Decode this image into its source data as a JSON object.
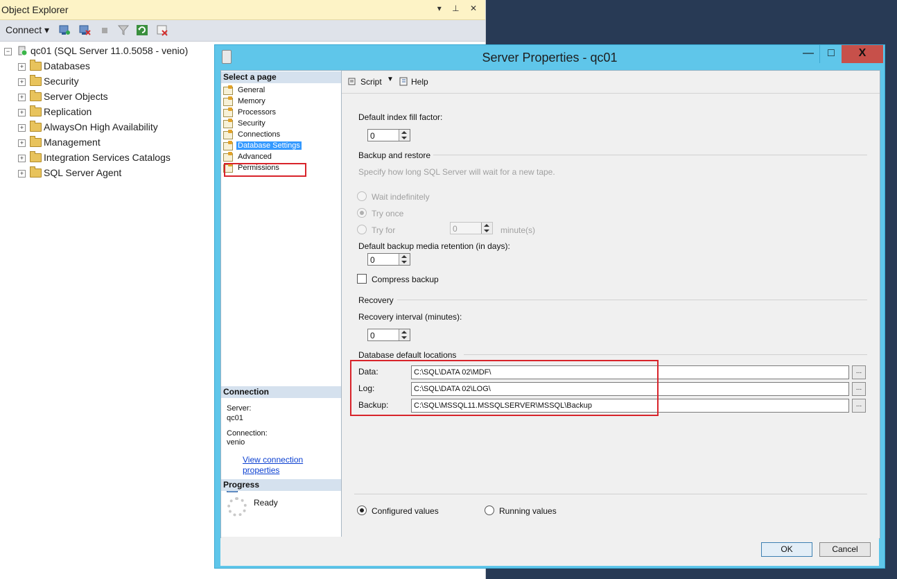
{
  "object_explorer": {
    "title": "Object Explorer",
    "title_icons": "▾ ⊥ ✕",
    "toolbar": {
      "connect_label": "Connect"
    },
    "server_node": "qc01 (SQL Server 11.0.5058 - venio)",
    "tree_items": [
      "Databases",
      "Security",
      "Server Objects",
      "Replication",
      "AlwaysOn High Availability",
      "Management",
      "Integration Services Catalogs",
      "SQL Server Agent"
    ]
  },
  "dialog": {
    "title": "Server Properties - qc01",
    "window_buttons": {
      "minimize": "—",
      "maximize": "□",
      "close": "X"
    },
    "left": {
      "select_page_header": "Select a page",
      "pages": [
        "General",
        "Memory",
        "Processors",
        "Security",
        "Connections",
        "Database Settings",
        "Advanced",
        "Permissions"
      ],
      "selected_page": "Database Settings",
      "connection_header": "Connection",
      "server_label": "Server:",
      "server_value": "qc01",
      "connection_label": "Connection:",
      "connection_value": "venio",
      "view_link_line1": "View connection",
      "view_link_line2": "properties",
      "progress_header": "Progress",
      "progress_status": "Ready"
    },
    "toolbar": {
      "script_label": "Script",
      "help_label": "Help"
    },
    "form": {
      "fill_factor_label": "Default index fill factor:",
      "fill_factor_value": "0",
      "backup_section": "Backup and restore",
      "backup_desc": "Specify how long SQL Server will wait for a new tape.",
      "wait_indefinitely": "Wait indefinitely",
      "try_once": "Try once",
      "try_for": "Try for",
      "try_for_value": "0",
      "minutes_label": "minute(s)",
      "retention_label": "Default backup media retention (in days):",
      "retention_value": "0",
      "compress_label": "Compress backup",
      "recovery_section": "Recovery",
      "recovery_interval_label": "Recovery interval (minutes):",
      "recovery_interval_value": "0",
      "locations_section": "Database default locations",
      "data_label": "Data:",
      "data_path": "C:\\SQL\\DATA 02\\MDF\\",
      "log_label": "Log:",
      "log_path": "C:\\SQL\\DATA 02\\LOG\\",
      "backup_label": "Backup:",
      "backup_path": "C:\\SQL\\MSSQL11.MSSQLSERVER\\MSSQL\\Backup",
      "browse": "...",
      "configured_values": "Configured values",
      "running_values": "Running values"
    },
    "footer": {
      "ok": "OK",
      "cancel": "Cancel"
    }
  },
  "colors": {
    "dialog_chrome": "#5fc6ea",
    "highlight_box": "#d8232a",
    "selected_page": "#3399ff",
    "desktop": "#283a55"
  }
}
